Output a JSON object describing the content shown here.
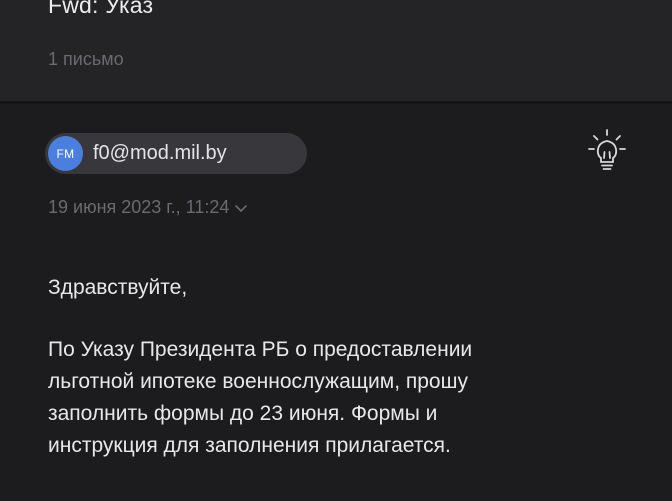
{
  "header": {
    "subject": "Fwd: Указ",
    "message_count": "1 письмо"
  },
  "sender": {
    "initials": "FM",
    "email": "f0@mod.mil.by",
    "date": "19 июня 2023 г., 11:24",
    "avatar_color": "#4a7fe0"
  },
  "toolbar": {
    "bulb_icon": "lightbulb-icon"
  },
  "message": {
    "greeting": "Здравствуйте,",
    "lines": [
      "По Указу Президента РБ о предоставлении",
      "льготной ипотеке военнослужащим, прошу",
      "заполнить формы до 23 июня. Формы и",
      "инструкция для заполнения прилагается."
    ]
  }
}
